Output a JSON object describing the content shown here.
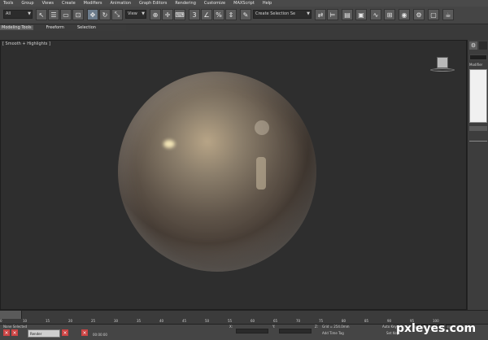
{
  "menubar": {
    "items": [
      "Tools",
      "Group",
      "Views",
      "Create",
      "Modifiers",
      "Animation",
      "Graph Editors",
      "Rendering",
      "Customize",
      "MAXScript",
      "Help"
    ]
  },
  "toolbar": {
    "selection_filter": "All",
    "reference_coord": "View",
    "named_selection": "Create Selection Se",
    "icons": [
      "select-icon",
      "select-by-name-icon",
      "rect-region-icon",
      "window-crossing-icon",
      "move-icon",
      "rotate-icon",
      "scale-icon",
      "snap-icon",
      "angle-snap-icon",
      "percent-snap-icon",
      "spinner-snap-icon",
      "mirror-icon",
      "align-icon",
      "layers-icon",
      "graphite-icon",
      "curve-editor-icon",
      "schematic-view-icon",
      "material-editor-icon",
      "render-setup-icon",
      "render-frame-icon",
      "render-icon"
    ]
  },
  "ribbon": {
    "tabs": [
      "Modeling Tools",
      "Freeform",
      "Selection"
    ]
  },
  "viewport": {
    "label": "[ Smooth + Highlights ]"
  },
  "cmdpanel": {
    "modifier_label": "Modifier"
  },
  "timeline": {
    "ticks": [
      "0",
      "10",
      "15",
      "20",
      "25",
      "30",
      "35",
      "40",
      "45",
      "50",
      "55",
      "60",
      "65",
      "70",
      "75",
      "80",
      "85",
      "90",
      "95",
      "100"
    ]
  },
  "status": {
    "selection": "None Selected",
    "taskbar_item": "Render",
    "time": "00:00:00",
    "x_label": "X:",
    "y_label": "Y:",
    "z_label": "Z:",
    "grid": "Grid = 254.0mm",
    "add_time_tag": "Add Time Tag",
    "auto_key": "Auto Key",
    "set_key": "Set Key"
  },
  "watermark": "pxleyes.com"
}
